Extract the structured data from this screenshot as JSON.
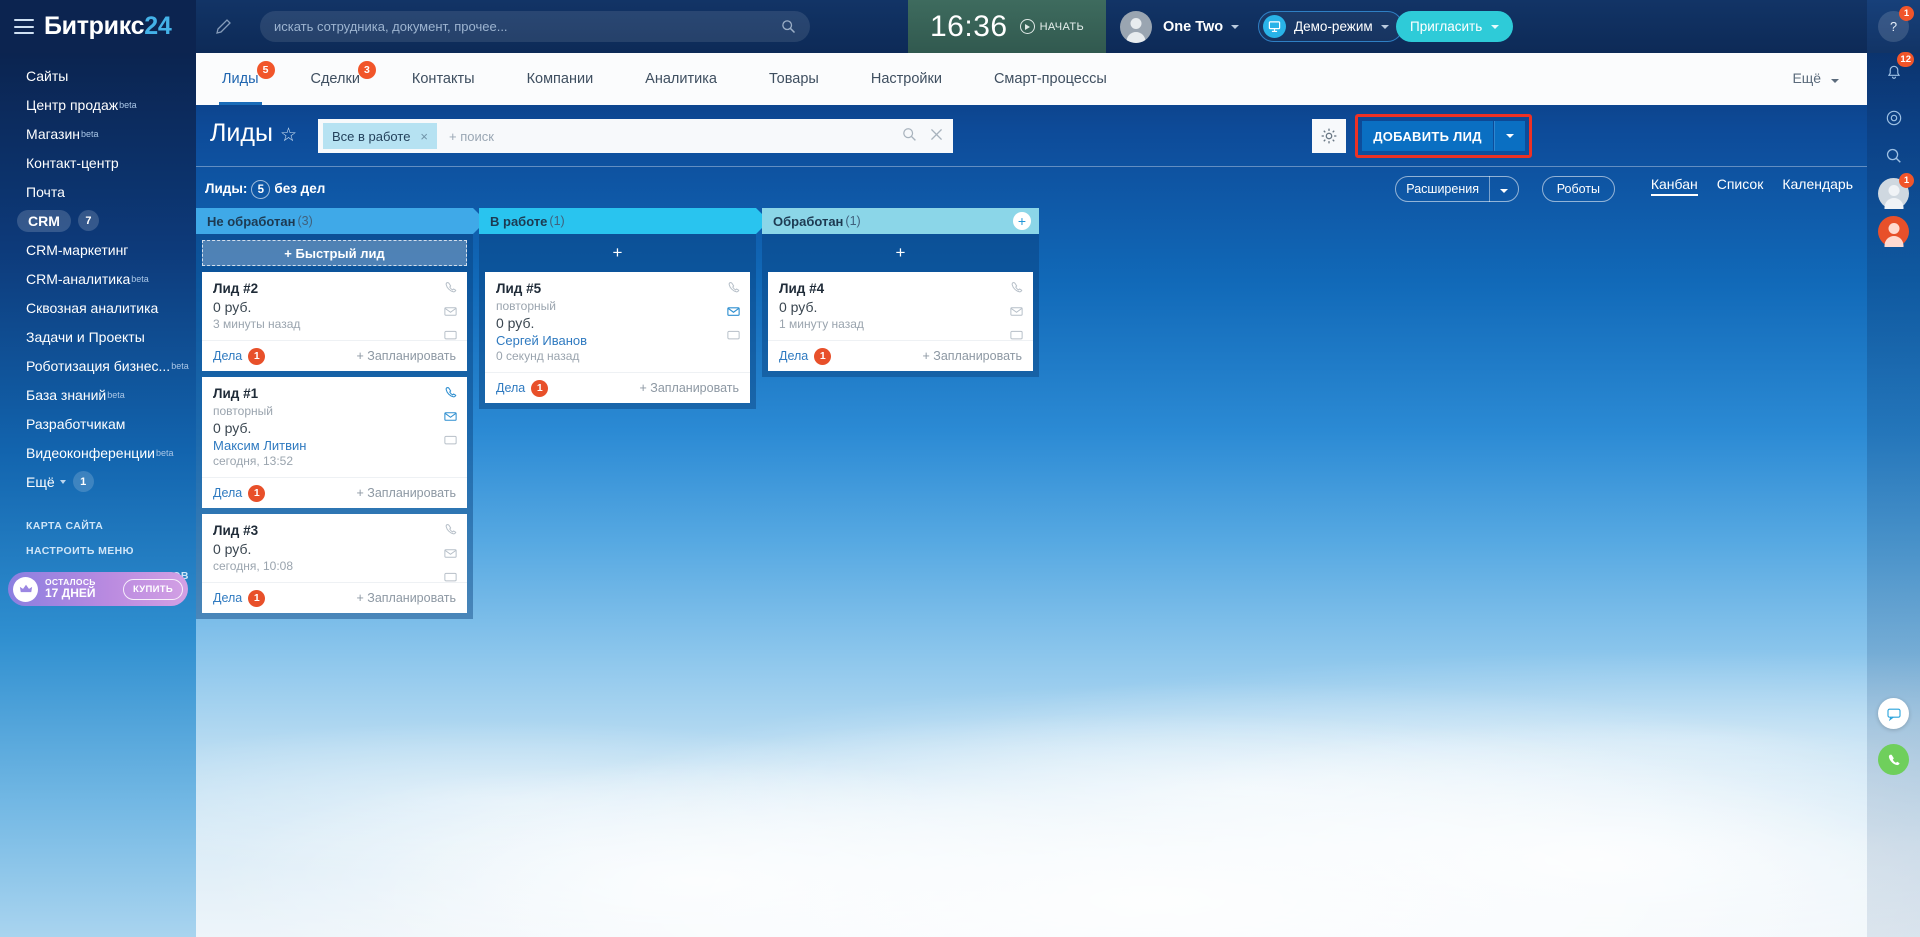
{
  "header": {
    "logo_main": "Битрикс",
    "logo_num": "24",
    "search_placeholder": "искать сотрудника, документ, прочее...",
    "search_value": "",
    "clock_time": "16:36",
    "clock_start_label": "НАЧАТЬ",
    "user_name": "One Two",
    "demo_label": "Демо-режим",
    "invite_label": "Пригласить"
  },
  "right_rail": {
    "help_badge": "1",
    "bell_badge": "12",
    "avatar_badge": "1"
  },
  "nav_tabs": [
    {
      "label": "Лиды",
      "badge": "5",
      "active": true
    },
    {
      "label": "Сделки",
      "badge": "3",
      "active": false
    },
    {
      "label": "Контакты",
      "badge": "",
      "active": false
    },
    {
      "label": "Компании",
      "badge": "",
      "active": false
    },
    {
      "label": "Аналитика",
      "badge": "",
      "active": false
    },
    {
      "label": "Товары",
      "badge": "",
      "active": false
    },
    {
      "label": "Настройки",
      "badge": "",
      "active": false
    },
    {
      "label": "Смарт-процессы",
      "badge": "",
      "active": false
    }
  ],
  "nav_more": "Ещё",
  "toolbar": {
    "page_title": "Лиды",
    "filter_chip": "Все в работе",
    "filter_placeholder": "+ поиск",
    "add_lead_label": "ДОБАВИТЬ ЛИД"
  },
  "subbar": {
    "leads_label": "Лиды:",
    "leads_count": "5",
    "leads_suffix": "без дел",
    "extensions_label": "Расширения",
    "robots_label": "Роботы",
    "views": [
      {
        "label": "Канбан",
        "active": true
      },
      {
        "label": "Список",
        "active": false
      },
      {
        "label": "Календарь",
        "active": false
      }
    ]
  },
  "kanban": {
    "columns": [
      {
        "title": "Не обработан",
        "count": "(3)",
        "color": "#3fa9e8",
        "add_label": "+ Быстрый лид",
        "add_style": "dashed",
        "has_plus_circle": false,
        "cards": [
          {
            "title": "Лид #2",
            "subtitle": "",
            "sum": "0 руб.",
            "person": "",
            "time": "3 минуты назад",
            "deals_label": "Дела",
            "deals_badge": "1",
            "plan_label": "+ Запланировать"
          },
          {
            "title": "Лид #1",
            "subtitle": "повторный",
            "sum": "0 руб.",
            "person": "Максим Литвин",
            "time": "сегодня, 13:52",
            "deals_label": "Дела",
            "deals_badge": "1",
            "plan_label": "+ Запланировать"
          },
          {
            "title": "Лид #3",
            "subtitle": "",
            "sum": "0 руб.",
            "person": "",
            "time": "сегодня, 10:08",
            "deals_label": "Дела",
            "deals_badge": "1",
            "plan_label": "+ Запланировать"
          }
        ]
      },
      {
        "title": "В работе",
        "count": "(1)",
        "color": "#29c4ef",
        "add_label": "+",
        "add_style": "plain",
        "has_plus_circle": false,
        "cards": [
          {
            "title": "Лид #5",
            "subtitle": "повторный",
            "sum": "0 руб.",
            "person": "Сергей Иванов",
            "time": "0 секунд назад",
            "deals_label": "Дела",
            "deals_badge": "1",
            "plan_label": "+ Запланировать"
          }
        ]
      },
      {
        "title": "Обработан",
        "count": "(1)",
        "color": "#8bd6e8",
        "add_label": "+",
        "add_style": "plain",
        "has_plus_circle": true,
        "cards": [
          {
            "title": "Лид #4",
            "subtitle": "",
            "sum": "0 руб.",
            "person": "",
            "time": "1 минуту назад",
            "deals_label": "Дела",
            "deals_badge": "1",
            "plan_label": "+ Запланировать"
          }
        ]
      }
    ]
  },
  "sidebar": {
    "items": [
      {
        "label": "Сайты",
        "beta": "",
        "badge": "",
        "pill": false
      },
      {
        "label": "Центр продаж",
        "beta": "beta",
        "badge": "",
        "pill": false
      },
      {
        "label": "Магазин",
        "beta": "beta",
        "badge": "",
        "pill": false
      },
      {
        "label": "Контакт-центр",
        "beta": "",
        "badge": "",
        "pill": false
      },
      {
        "label": "Почта",
        "beta": "",
        "badge": "",
        "pill": false
      },
      {
        "label": "CRM",
        "beta": "",
        "badge": "7",
        "pill": true
      },
      {
        "label": "CRM-маркетинг",
        "beta": "",
        "badge": "",
        "pill": false
      },
      {
        "label": "CRM-аналитика",
        "beta": "beta",
        "badge": "",
        "pill": false
      },
      {
        "label": "Сквозная аналитика",
        "beta": "",
        "badge": "",
        "pill": false
      },
      {
        "label": "Задачи и Проекты",
        "beta": "",
        "badge": "",
        "pill": false
      },
      {
        "label": "Роботизация бизнес...",
        "beta": "beta",
        "badge": "",
        "pill": false
      },
      {
        "label": "База знаний",
        "beta": "beta",
        "badge": "",
        "pill": false
      },
      {
        "label": "Разработчикам",
        "beta": "",
        "badge": "",
        "pill": false
      },
      {
        "label": "Видеоконференции",
        "beta": "beta",
        "badge": "",
        "pill": false
      },
      {
        "label": "Ещё",
        "beta": "",
        "badge": "1",
        "pill": false,
        "caret": true
      }
    ],
    "links": [
      {
        "label": "КАРТА САЙТА"
      },
      {
        "label": "НАСТРОИТЬ МЕНЮ"
      },
      {
        "label": "ПРИГЛАСИТЬ СОТРУДНИКОВ"
      }
    ],
    "promo": {
      "line1": "ОСТАЛОСЬ",
      "line2": "17 ДНЕЙ",
      "button": "КУПИТЬ"
    }
  },
  "colors": {
    "accent_blue": "#0a6fc2",
    "highlight_red": "#ee3124",
    "badge_orange": "#f1552a",
    "teal": "#2ecbd8"
  }
}
